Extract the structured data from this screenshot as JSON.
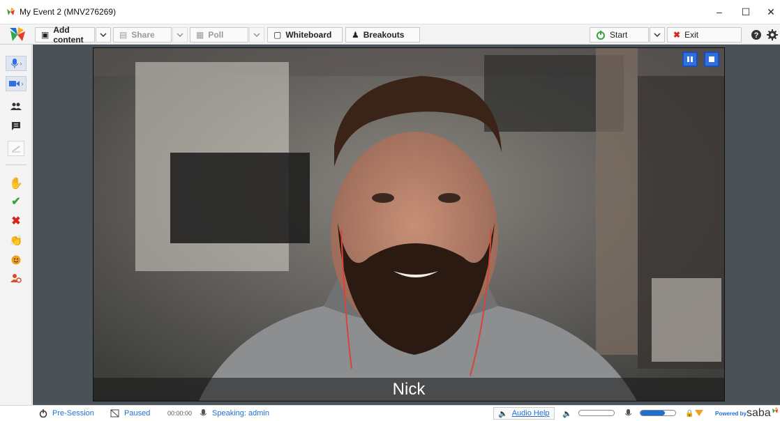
{
  "window": {
    "title": "My Event 2 (MNV276269)"
  },
  "toolbar": {
    "add_content": "Add content",
    "share": "Share",
    "poll": "Poll",
    "whiteboard": "Whiteboard",
    "breakouts": "Breakouts",
    "start": "Start",
    "exit": "Exit"
  },
  "leftbar": {
    "tools": [
      "microphone-icon",
      "camera-icon",
      "participants-icon",
      "chat-icon",
      "pen-icon"
    ],
    "feedback": [
      "raise-hand-icon",
      "yes-check-icon",
      "no-x-icon",
      "applause-icon",
      "smile-icon",
      "step-away-icon"
    ]
  },
  "video": {
    "participant_name": "Nick"
  },
  "status": {
    "session_state": "Pre-Session",
    "recording_state": "Paused",
    "timer": "00:00:00",
    "speaking": "Speaking: admin",
    "audio_help": "Audio Help",
    "speaker_volume_level": 0.0,
    "mic_level": 0.7,
    "powered_by": "Powered by",
    "brand": "saba"
  },
  "colors": {
    "accent": "#1f6fd0",
    "exit_red": "#d9261c",
    "start_green": "#3aa33a",
    "feedback_orange": "#f0a020"
  }
}
